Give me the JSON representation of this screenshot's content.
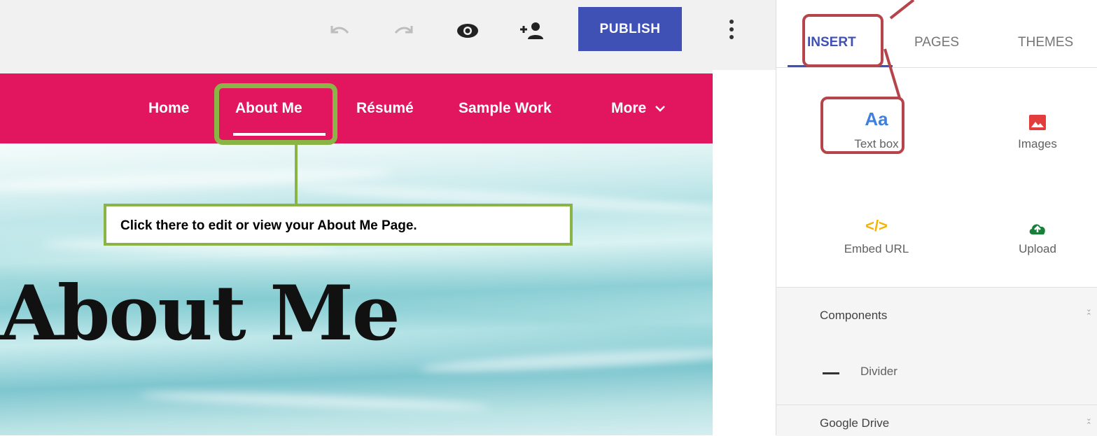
{
  "toolbar": {
    "undo_icon": "undo-icon",
    "redo_icon": "redo-icon",
    "preview_icon": "eye-icon",
    "share_icon": "add-person-icon",
    "publish_label": "PUBLISH",
    "more_icon": "more-vert-icon"
  },
  "site": {
    "nav": [
      {
        "label": "Home"
      },
      {
        "label": "About Me"
      },
      {
        "label": "Résumé"
      },
      {
        "label": "Sample Work"
      },
      {
        "label": "More"
      }
    ],
    "hero_title": "About Me",
    "nav_color": "#e2165e"
  },
  "annotation": {
    "callout_text": "Click there to edit or view your About Me Page.",
    "green": "#8ab546",
    "red": "#b5454a"
  },
  "panel": {
    "tabs": [
      {
        "label": "INSERT",
        "active": true
      },
      {
        "label": "PAGES",
        "active": false
      },
      {
        "label": "THEMES",
        "active": false
      }
    ],
    "insert_items": [
      {
        "label": "Text box",
        "icon": "text-box-icon",
        "glyph": "Aa"
      },
      {
        "label": "Images",
        "icon": "image-icon"
      },
      {
        "label": "Embed URL",
        "icon": "code-icon",
        "glyph": "</>"
      },
      {
        "label": "Upload",
        "icon": "cloud-upload-icon"
      }
    ],
    "sections": [
      {
        "title": "Components",
        "items": [
          {
            "label": "Divider",
            "icon": "divider-icon"
          }
        ]
      },
      {
        "title": "Google Drive"
      }
    ],
    "accent": "#3f51b5"
  }
}
